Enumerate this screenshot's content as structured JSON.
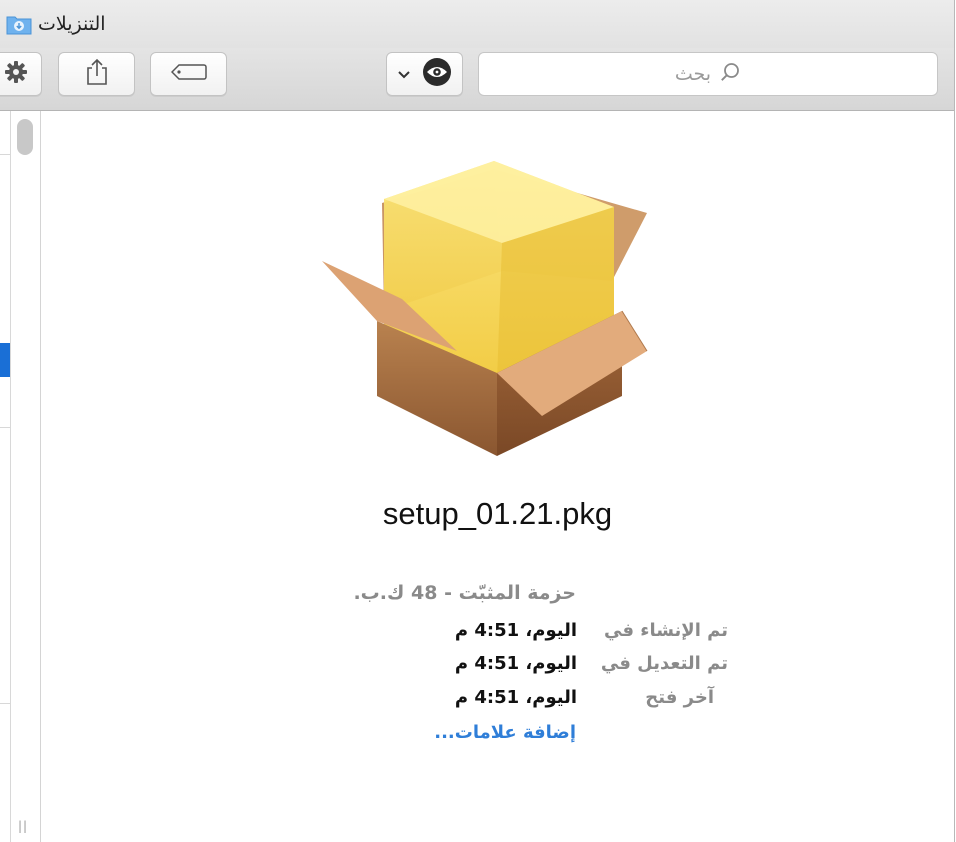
{
  "window": {
    "title": "التنزيلات"
  },
  "toolbar": {
    "actions_icon": "gear-icon",
    "share_icon": "share-icon",
    "tags_icon": "tag-icon",
    "view_icon": "eye-icon",
    "search_placeholder": "بحث"
  },
  "preview": {
    "icon": "package-icon",
    "filename": "setup_01.21.pkg",
    "kind": "حزمة المثبّت - 48 ك.ب.",
    "rows": [
      {
        "label": "تم الإنشاء في",
        "value": "اليوم، 4:51 م"
      },
      {
        "label": "تم التعديل في",
        "value": "اليوم، 4:51 م"
      },
      {
        "label": "آخر فتح",
        "value": "اليوم، 4:51 م"
      }
    ],
    "add_tags": "إضافة علامات..."
  },
  "colors": {
    "link": "#2f7ed8",
    "selection": "#1a6fd6",
    "label_gray": "#8a8a8a"
  }
}
